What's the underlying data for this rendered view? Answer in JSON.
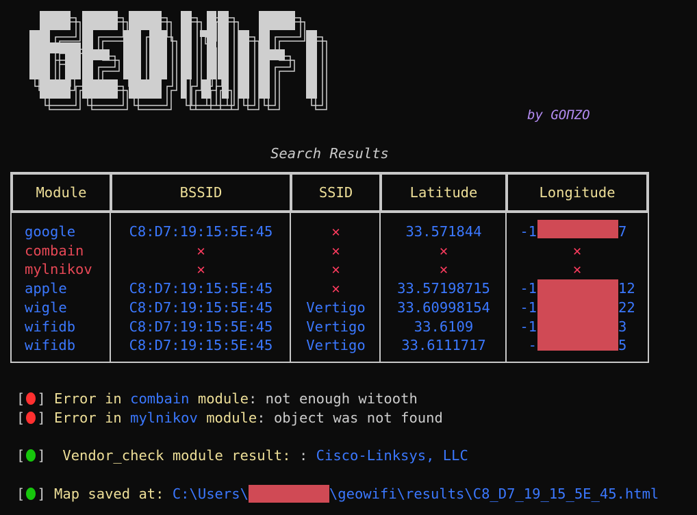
{
  "logo": {
    "text": "GEOWiFi",
    "byline": "by GOПZO"
  },
  "title": "Search Results",
  "table": {
    "headers": [
      "Module",
      "BSSID",
      "SSID",
      "Latitude",
      "Longitude"
    ],
    "rows": [
      {
        "module": "google",
        "status": "ok",
        "bssid": "C8:D7:19:15:5E:45",
        "ssid": "✕",
        "lat": "33.571844",
        "lon_prefix": "-1",
        "lon_suffix": "7"
      },
      {
        "module": "combain",
        "status": "error",
        "bssid": "✕",
        "ssid": "✕",
        "lat": "✕",
        "lon": "✕"
      },
      {
        "module": "mylnikov",
        "status": "error",
        "bssid": "✕",
        "ssid": "✕",
        "lat": "✕",
        "lon": "✕"
      },
      {
        "module": "apple",
        "status": "ok",
        "bssid": "C8:D7:19:15:5E:45",
        "ssid": "✕",
        "lat": "33.57198715",
        "lon_prefix": "-1",
        "lon_suffix": "12"
      },
      {
        "module": "wigle",
        "status": "ok",
        "bssid": "C8:D7:19:15:5E:45",
        "ssid": "Vertigo",
        "lat": "33.60998154",
        "lon_prefix": "-1",
        "lon_suffix": "22"
      },
      {
        "module": "wifidb",
        "status": "ok",
        "bssid": "C8:D7:19:15:5E:45",
        "ssid": "Vertigo",
        "lat": "33.6109",
        "lon_prefix": "-1",
        "lon_suffix": "3"
      },
      {
        "module": "wifidb",
        "status": "ok",
        "bssid": "C8:D7:19:15:5E:45",
        "ssid": "Vertigo",
        "lat": "33.6111717",
        "lon_prefix": "-",
        "lon_suffix": "5"
      }
    ]
  },
  "log": [
    {
      "status": "error",
      "prefix": "Error in ",
      "module": "combain",
      "mid": " module",
      "colon": ": ",
      "message": "not enough witooth"
    },
    {
      "status": "error",
      "prefix": "Error in ",
      "module": "mylnikov",
      "mid": " module",
      "colon": ": ",
      "message": "object was not found"
    },
    {
      "status": "success",
      "label": " Vendor_check module result: ",
      "sep": ": ",
      "value": "Cisco-Linksys, LLC"
    },
    {
      "status": "success",
      "label": "Map saved at: ",
      "path_start": "C:\\Users\\",
      "path_end": "\\geowifi\\results\\C8_D7_19_15_5E_45.html"
    }
  ],
  "colors": {
    "error": "#ff3030",
    "success": "#16c60c",
    "accent": "#3b78ff",
    "label": "#eedf98",
    "redaction": "#d04a55"
  }
}
